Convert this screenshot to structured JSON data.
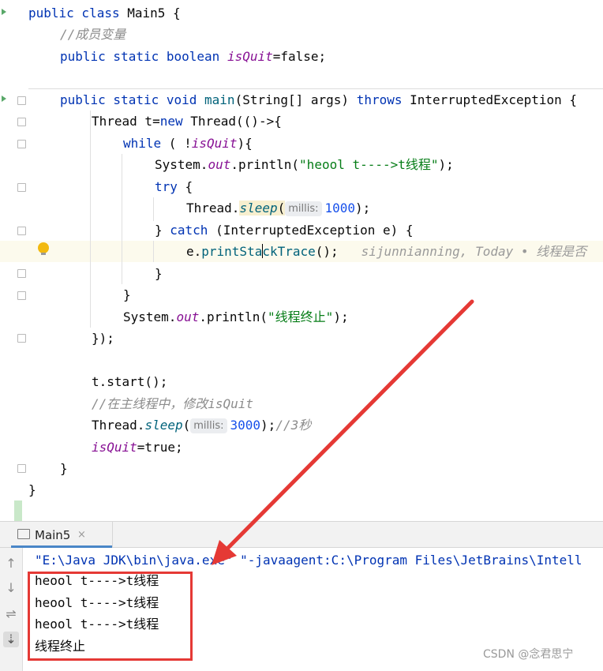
{
  "editor": {
    "lines": {
      "l1": {
        "kw": "public class",
        "rest": " Main5 {"
      },
      "l2": {
        "comment": "//成员变量"
      },
      "l3": {
        "kw": "public static boolean",
        "field": "isQuit",
        "rest": "=false;"
      },
      "l4": {
        "kw": "public static void",
        "method": "main",
        "rest1": "(String[] args) ",
        "throws": "throws",
        "rest2": " InterruptedException {"
      },
      "l5": {
        "pre": "Thread t=",
        "kw": "new",
        "rest": " Thread(()->{"
      },
      "l6": {
        "kw": "while",
        "pre": " ( !",
        "field": "isQuit",
        "rest": "){"
      },
      "l7": {
        "pre": "System.",
        "field": "out",
        "mid": ".println(",
        "str": "\"heool t---->t线程\"",
        "rest": ");"
      },
      "l8": {
        "kw": "try",
        "rest": " {"
      },
      "l9": {
        "pre": "Thread.",
        "method": "sleep",
        "paren": "(",
        "hint": "millis:",
        "num": "1000",
        "rest": ");"
      },
      "l10": {
        "pre": "} ",
        "kw": "catch",
        "rest": " (InterruptedException e) {"
      },
      "l11": {
        "pre": "e.",
        "method_a": "printSta",
        "method_b": "ckTrace",
        "rest": "();",
        "blame": "sijunnianning, Today • 线程是否"
      },
      "l12": {
        "text": "}"
      },
      "l13": {
        "text": "}"
      },
      "l14": {
        "pre": "System.",
        "field": "out",
        "mid": ".println(",
        "str": "\"线程终止\"",
        "rest": ");"
      },
      "l15": {
        "text": "});"
      },
      "l16": {
        "text": "t.start();"
      },
      "l17": {
        "comment": "//在主线程中，修改isQuit"
      },
      "l18": {
        "pre": "Thread.",
        "method": "sleep",
        "paren": "(",
        "hint": "millis:",
        "num": "3000",
        "rest": ");",
        "comment": "//3秒"
      },
      "l19": {
        "field": "isQuit",
        "rest": "=true;"
      },
      "l20": {
        "text": "}"
      },
      "l21": {
        "text": "}"
      }
    }
  },
  "run_panel": {
    "tab_label": "Main5",
    "tab_close": "×",
    "command": "\"E:\\Java JDK\\bin\\java.exe\" \"-javaagent:C:\\Program Files\\JetBrains\\Intell",
    "output": [
      "heool t---->t线程",
      "heool t---->t线程",
      "heool t---->t线程",
      "线程终止"
    ]
  },
  "tools": {
    "up": "↑",
    "down": "↓",
    "wrap": "⇌",
    "scroll": "⇣"
  },
  "watermark": "CSDN @念君思宁",
  "colors": {
    "keyword": "#0033b3",
    "field": "#871094",
    "string": "#067d17",
    "number": "#1750eb",
    "annotation_red": "#e53935"
  }
}
